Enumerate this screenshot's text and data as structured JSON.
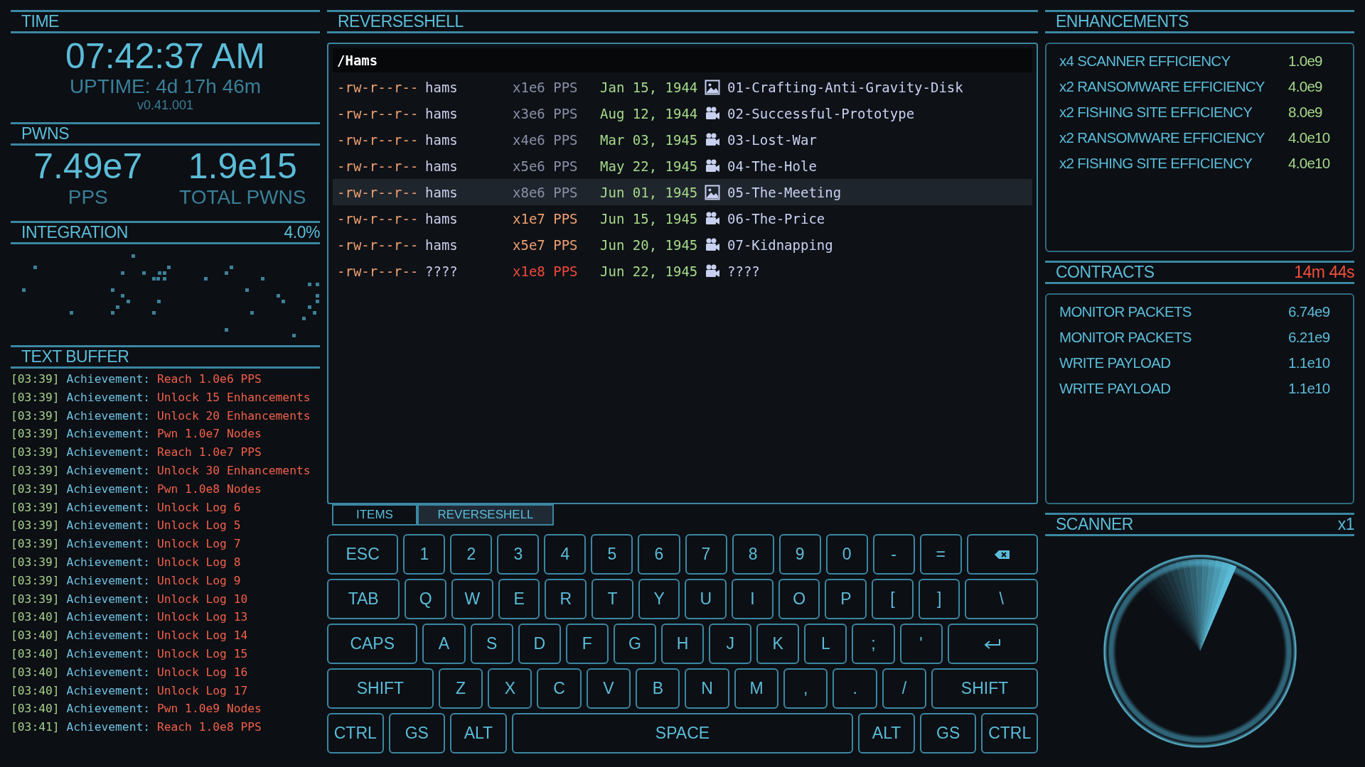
{
  "time_panel": {
    "title": "TIME",
    "clock": "07:42:37 AM",
    "uptime": "UPTIME: 4d 17h 46m",
    "version": "v0.41.001"
  },
  "pwns_panel": {
    "title": "PWNS",
    "stats": [
      {
        "value": "7.49e7",
        "label": "PPS"
      },
      {
        "value": "1.9e15",
        "label": "TOTAL PWNS"
      }
    ]
  },
  "integration_panel": {
    "title": "INTEGRATION",
    "percent": "4.0%"
  },
  "text_buffer": {
    "title": "TEXT BUFFER",
    "lines": [
      {
        "time": "[03:39]",
        "source": "Achievement:",
        "message": "Reach 1.0e6 PPS"
      },
      {
        "time": "[03:39]",
        "source": "Achievement:",
        "message": "Unlock 15 Enhancements"
      },
      {
        "time": "[03:39]",
        "source": "Achievement:",
        "message": "Unlock 20 Enhancements"
      },
      {
        "time": "[03:39]",
        "source": "Achievement:",
        "message": "Pwn 1.0e7 Nodes"
      },
      {
        "time": "[03:39]",
        "source": "Achievement:",
        "message": "Reach 1.0e7 PPS"
      },
      {
        "time": "[03:39]",
        "source": "Achievement:",
        "message": "Unlock 30 Enhancements"
      },
      {
        "time": "[03:39]",
        "source": "Achievement:",
        "message": "Pwn 1.0e8 Nodes"
      },
      {
        "time": "[03:39]",
        "source": "Achievement:",
        "message": "Unlock Log 6"
      },
      {
        "time": "[03:39]",
        "source": "Achievement:",
        "message": "Unlock Log 5"
      },
      {
        "time": "[03:39]",
        "source": "Achievement:",
        "message": "Unlock Log 7"
      },
      {
        "time": "[03:39]",
        "source": "Achievement:",
        "message": "Unlock Log 8"
      },
      {
        "time": "[03:39]",
        "source": "Achievement:",
        "message": "Unlock Log 9"
      },
      {
        "time": "[03:39]",
        "source": "Achievement:",
        "message": "Unlock Log 10"
      },
      {
        "time": "[03:40]",
        "source": "Achievement:",
        "message": "Unlock Log 13"
      },
      {
        "time": "[03:40]",
        "source": "Achievement:",
        "message": "Unlock Log 14"
      },
      {
        "time": "[03:40]",
        "source": "Achievement:",
        "message": "Unlock Log 15"
      },
      {
        "time": "[03:40]",
        "source": "Achievement:",
        "message": "Unlock Log 16"
      },
      {
        "time": "[03:40]",
        "source": "Achievement:",
        "message": "Unlock Log 17"
      },
      {
        "time": "[03:40]",
        "source": "Achievement:",
        "message": "Pwn 1.0e9 Nodes"
      },
      {
        "time": "[03:41]",
        "source": "Achievement:",
        "message": "Reach 1.0e8 PPS"
      }
    ]
  },
  "reverseshell": {
    "title": "REVERSESHELL",
    "path": "/Hams",
    "files": [
      {
        "permissions": "-rw-r--r--",
        "owner": "hams",
        "multiplier": "x1e6 PPS",
        "color": "#8a90a8",
        "date": "Jan 15, 1944",
        "kind": "image",
        "name": "01-Crafting-Anti-Gravity-Disk",
        "selected": false
      },
      {
        "permissions": "-rw-r--r--",
        "owner": "hams",
        "multiplier": "x3e6 PPS",
        "color": "#8a90a8",
        "date": "Aug 12, 1944",
        "kind": "video",
        "name": "02-Successful-Prototype",
        "selected": false
      },
      {
        "permissions": "-rw-r--r--",
        "owner": "hams",
        "multiplier": "x4e6 PPS",
        "color": "#8a90a8",
        "date": "Mar 03, 1945",
        "kind": "video",
        "name": "03-Lost-War",
        "selected": false
      },
      {
        "permissions": "-rw-r--r--",
        "owner": "hams",
        "multiplier": "x5e6 PPS",
        "color": "#8a90a8",
        "date": "May 22, 1945",
        "kind": "video",
        "name": "04-The-Hole",
        "selected": false
      },
      {
        "permissions": "-rw-r--r--",
        "owner": "hams",
        "multiplier": "x8e6 PPS",
        "color": "#8a90a8",
        "date": "Jun 01, 1945",
        "kind": "image",
        "name": "05-The-Meeting",
        "selected": true
      },
      {
        "permissions": "-rw-r--r--",
        "owner": "hams",
        "multiplier": "x1e7 PPS",
        "color": "#f0a070",
        "date": "Jun 15, 1945",
        "kind": "video",
        "name": "06-The-Price",
        "selected": false
      },
      {
        "permissions": "-rw-r--r--",
        "owner": "hams",
        "multiplier": "x5e7 PPS",
        "color": "#f0a070",
        "date": "Jun 20, 1945",
        "kind": "video",
        "name": "07-Kidnapping",
        "selected": false
      },
      {
        "permissions": "-rw-r--r--",
        "owner": "????",
        "multiplier": "x1e8 PPS",
        "color": "#f04a3a",
        "date": "Jun 22, 1945",
        "kind": "video",
        "name": "????",
        "selected": false
      }
    ],
    "tabs": [
      {
        "label": "ITEMS",
        "selected": false
      },
      {
        "label": "REVERSESHELL",
        "selected": true
      }
    ]
  },
  "keyboard": {
    "rows": [
      {
        "keys": [
          {
            "kind": "wide",
            "label": "ESC"
          },
          {
            "kind": "char",
            "label": "1"
          },
          {
            "kind": "char",
            "label": "2"
          },
          {
            "kind": "char",
            "label": "3"
          },
          {
            "kind": "char",
            "label": "4"
          },
          {
            "kind": "char",
            "label": "5"
          },
          {
            "kind": "char",
            "label": "6"
          },
          {
            "kind": "char",
            "label": "7"
          },
          {
            "kind": "char",
            "label": "8"
          },
          {
            "kind": "char",
            "label": "9"
          },
          {
            "kind": "char",
            "label": "0"
          },
          {
            "kind": "char",
            "label": "-"
          },
          {
            "kind": "char",
            "label": "="
          },
          {
            "kind": "backspace"
          }
        ]
      },
      {
        "keys": [
          {
            "kind": "wide",
            "label": "TAB"
          },
          {
            "kind": "char",
            "label": "Q"
          },
          {
            "kind": "char",
            "label": "W"
          },
          {
            "kind": "char",
            "label": "E"
          },
          {
            "kind": "char",
            "label": "R"
          },
          {
            "kind": "char",
            "label": "T"
          },
          {
            "kind": "char",
            "label": "Y"
          },
          {
            "kind": "char",
            "label": "U"
          },
          {
            "kind": "char",
            "label": "I"
          },
          {
            "kind": "char",
            "label": "O"
          },
          {
            "kind": "char",
            "label": "P"
          },
          {
            "kind": "char",
            "label": "["
          },
          {
            "kind": "char",
            "label": "]"
          },
          {
            "kind": "wide",
            "label": "\\"
          }
        ]
      },
      {
        "keys": [
          {
            "kind": "wide",
            "label": "CAPS"
          },
          {
            "kind": "char",
            "label": "A"
          },
          {
            "kind": "char",
            "label": "S"
          },
          {
            "kind": "char",
            "label": "D"
          },
          {
            "kind": "char",
            "label": "F"
          },
          {
            "kind": "char",
            "label": "G"
          },
          {
            "kind": "char",
            "label": "H"
          },
          {
            "kind": "char",
            "label": "J"
          },
          {
            "kind": "char",
            "label": "K"
          },
          {
            "kind": "char",
            "label": "L"
          },
          {
            "kind": "char",
            "label": ";"
          },
          {
            "kind": "char",
            "label": "'"
          },
          {
            "kind": "enter"
          }
        ]
      },
      {
        "keys": [
          {
            "kind": "wide",
            "label": "SHIFT"
          },
          {
            "kind": "char",
            "label": "Z"
          },
          {
            "kind": "char",
            "label": "X"
          },
          {
            "kind": "char",
            "label": "C"
          },
          {
            "kind": "char",
            "label": "V"
          },
          {
            "kind": "char",
            "label": "B"
          },
          {
            "kind": "char",
            "label": "N"
          },
          {
            "kind": "char",
            "label": "M"
          },
          {
            "kind": "char",
            "label": ","
          },
          {
            "kind": "char",
            "label": "."
          },
          {
            "kind": "char",
            "label": "/"
          },
          {
            "kind": "wide",
            "label": "SHIFT"
          }
        ]
      },
      {
        "keys": [
          {
            "kind": "wide",
            "label": "CTRL"
          },
          {
            "kind": "wide",
            "label": "GS"
          },
          {
            "kind": "wide",
            "label": "ALT"
          },
          {
            "kind": "space",
            "label": "SPACE"
          },
          {
            "kind": "wide",
            "label": "ALT"
          },
          {
            "kind": "wide",
            "label": "GS"
          },
          {
            "kind": "wide",
            "label": "CTRL"
          }
        ]
      }
    ]
  },
  "enhancements": {
    "title": "ENHANCEMENTS",
    "items": [
      {
        "name": "x4 SCANNER EFFICIENCY",
        "cost": "1.0e9"
      },
      {
        "name": "x2 RANSOMWARE EFFICIENCY",
        "cost": "4.0e9"
      },
      {
        "name": "x2 FISHING SITE EFFICIENCY",
        "cost": "8.0e9"
      },
      {
        "name": "x2 RANSOMWARE EFFICIENCY",
        "cost": "4.0e10"
      },
      {
        "name": "x2 FISHING SITE EFFICIENCY",
        "cost": "4.0e10"
      }
    ]
  },
  "contracts": {
    "title": "CONTRACTS",
    "timer": "14m 44s",
    "items": [
      {
        "name": "MONITOR PACKETS",
        "reward": "6.74e9"
      },
      {
        "name": "MONITOR PACKETS",
        "reward": "6.21e9"
      },
      {
        "name": "WRITE PAYLOAD",
        "reward": "1.1e10"
      },
      {
        "name": "WRITE PAYLOAD",
        "reward": "1.1e10"
      }
    ]
  },
  "scanner": {
    "title": "SCANNER",
    "multiplier": "x1"
  }
}
